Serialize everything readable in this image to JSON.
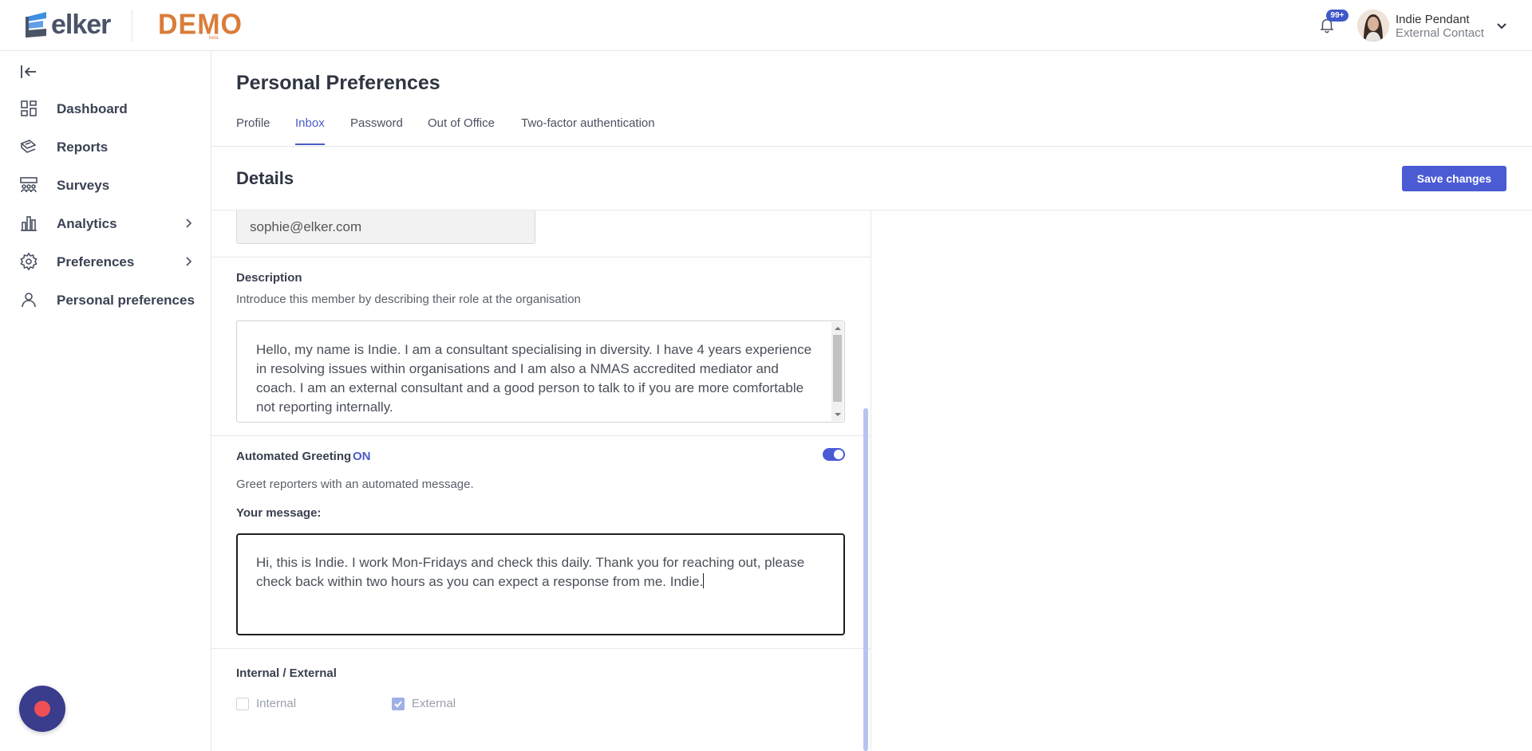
{
  "app": {
    "brand": "elker",
    "environment_badge": "DEMO",
    "environment_sub": "beta"
  },
  "header": {
    "notifications_badge": "99+",
    "user": {
      "name": "Indie Pendant",
      "role": "External Contact"
    }
  },
  "sidebar": {
    "items": [
      {
        "label": "Dashboard",
        "icon": "grid-icon"
      },
      {
        "label": "Reports",
        "icon": "reports-icon"
      },
      {
        "label": "Surveys",
        "icon": "surveys-icon"
      },
      {
        "label": "Analytics",
        "icon": "bar-chart-icon",
        "has_submenu": true
      },
      {
        "label": "Preferences",
        "icon": "gear-icon",
        "has_submenu": true
      },
      {
        "label": "Personal preferences",
        "icon": "user-icon"
      }
    ]
  },
  "page": {
    "title": "Personal Preferences",
    "tabs": [
      {
        "label": "Profile",
        "active": false
      },
      {
        "label": "Inbox",
        "active": true
      },
      {
        "label": "Password",
        "active": false
      },
      {
        "label": "Out of Office",
        "active": false
      },
      {
        "label": "Two-factor authentication",
        "active": false
      }
    ],
    "section_title": "Details",
    "save_label": "Save changes"
  },
  "form": {
    "email_value": "sophie@elker.com",
    "description": {
      "label": "Description",
      "help": "Introduce this member by describing their role at the organisation",
      "value": "Hello, my name is Indie. I am a consultant specialising in diversity. I have 4 years experience in resolving issues within organisations and I am also a NMAS accredited mediator and coach. I am an external consultant and a good person to talk to if you are more comfortable not reporting internally."
    },
    "greeting": {
      "label": "Automated Greeting",
      "state": "ON",
      "enabled": true,
      "help": "Greet reporters with an automated message.",
      "message_label": "Your message:",
      "message_value": "Hi, this is Indie. I work Mon-Fridays and check this daily. Thank you for reaching out, please check back within two hours as you can expect a response from me. Indie."
    },
    "internal_external": {
      "label": "Internal / External",
      "options": [
        {
          "label": "Internal",
          "checked": false
        },
        {
          "label": "External",
          "checked": true
        }
      ]
    }
  },
  "colors": {
    "accent": "#4a5bd4",
    "brand_text": "#4a5368",
    "demo_orange": "#d97d3a",
    "fab_bg": "#3a3c8c",
    "fab_dot": "#ef4f57"
  }
}
